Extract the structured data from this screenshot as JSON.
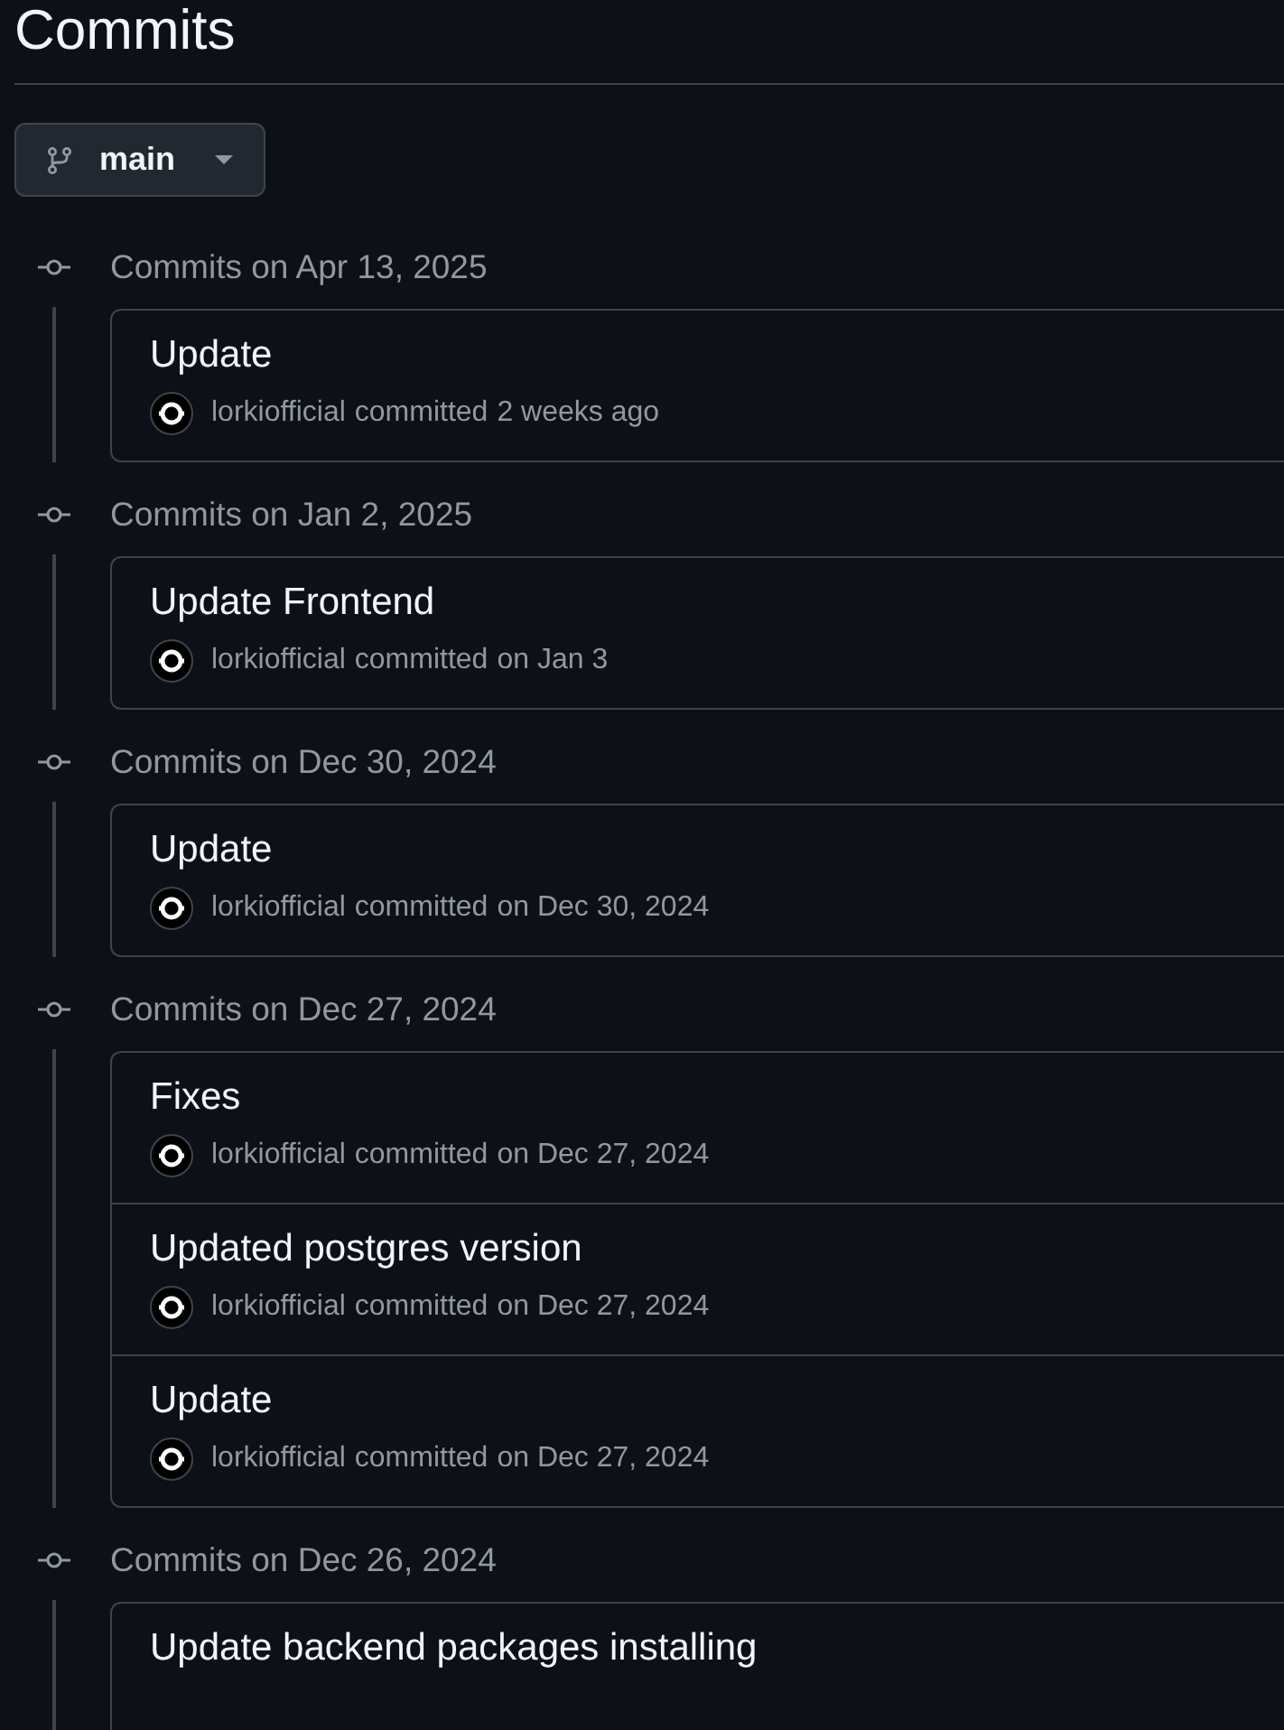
{
  "page_title": "Commits",
  "branch": {
    "name": "main"
  },
  "groups": [
    {
      "heading": "Commits on Apr 13, 2025",
      "commits": [
        {
          "message": "Update",
          "author": "lorkiofficial",
          "action": "committed",
          "when": "2 weeks ago"
        }
      ]
    },
    {
      "heading": "Commits on Jan 2, 2025",
      "commits": [
        {
          "message": "Update Frontend",
          "author": "lorkiofficial",
          "action": "committed",
          "when": "on Jan 3"
        }
      ]
    },
    {
      "heading": "Commits on Dec 30, 2024",
      "commits": [
        {
          "message": "Update",
          "author": "lorkiofficial",
          "action": "committed",
          "when": "on Dec 30, 2024"
        }
      ]
    },
    {
      "heading": "Commits on Dec 27, 2024",
      "commits": [
        {
          "message": "Fixes",
          "author": "lorkiofficial",
          "action": "committed",
          "when": "on Dec 27, 2024"
        },
        {
          "message": "Updated postgres version",
          "author": "lorkiofficial",
          "action": "committed",
          "when": "on Dec 27, 2024"
        },
        {
          "message": "Update",
          "author": "lorkiofficial",
          "action": "committed",
          "when": "on Dec 27, 2024"
        }
      ]
    },
    {
      "heading": "Commits on Dec 26, 2024",
      "commits": [
        {
          "message": "Update backend packages installing"
        }
      ]
    }
  ]
}
